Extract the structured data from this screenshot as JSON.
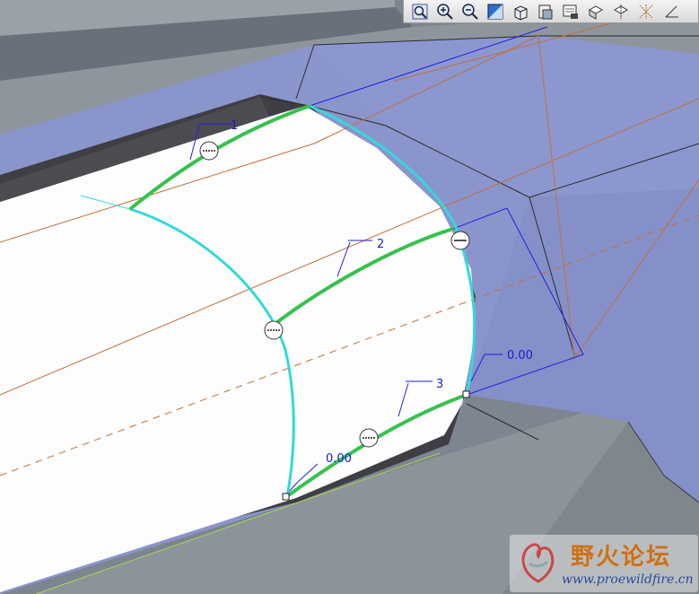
{
  "toolbar": {
    "buttons": [
      {
        "icon": "zoom-window-icon"
      },
      {
        "icon": "zoom-in-icon"
      },
      {
        "icon": "zoom-out-icon"
      },
      {
        "icon": "refit-icon"
      },
      {
        "icon": "view-cube-icon"
      },
      {
        "icon": "saved-views-icon"
      },
      {
        "icon": "view-manager-icon"
      },
      {
        "icon": "plane-display-icon"
      },
      {
        "icon": "axis-display-icon"
      },
      {
        "icon": "point-display-icon"
      },
      {
        "icon": "csys-display-icon"
      }
    ]
  },
  "model": {
    "curve_labels": [
      "1",
      "2",
      "3"
    ],
    "dimensions": [
      "0.00",
      "0.00"
    ]
  },
  "watermark": {
    "title": "野火论坛",
    "url": "www.proewildfire.cn"
  },
  "colors": {
    "background": "#7d8590",
    "blue_surface": "#8a95cc",
    "edge_cyan": "#35d8d8",
    "curve_green": "#35c24d",
    "annotation_blue": "#1a1ad0",
    "datum_orange": "#c0703a"
  }
}
